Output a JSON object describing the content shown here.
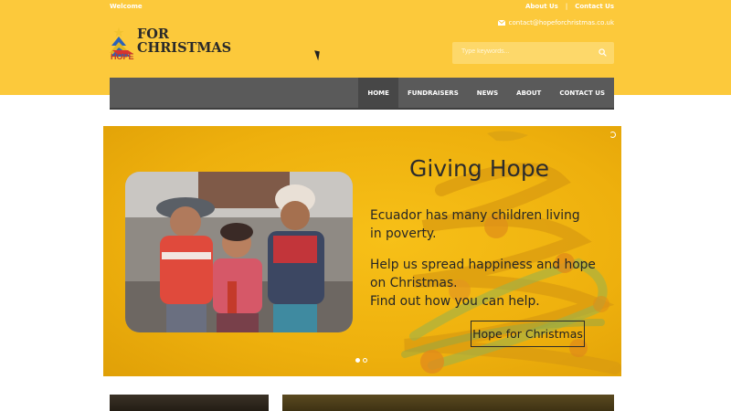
{
  "topbar": {
    "welcome": "Welcome",
    "links": [
      "About Us",
      "Contact Us"
    ],
    "separator": "|",
    "email": "contact@hopeforchristmas.co.uk"
  },
  "logo": {
    "line1": "FOR",
    "line2": "CHRISTMAS",
    "hope": "HOPE"
  },
  "search": {
    "placeholder": "Type keywords..."
  },
  "nav": {
    "items": [
      "HOME",
      "FUNDRAISERS",
      "NEWS",
      "ABOUT",
      "CONTACT US"
    ],
    "active": "HOME"
  },
  "slide": {
    "title": "Giving Hope",
    "line1": "Ecuador has many children living",
    "line2": "in poverty.",
    "line3": "Help us spread happiness and hope",
    "line4": "on Christmas.",
    "line5": "Find out how you can help.",
    "button": "Hope for Christmas",
    "dots": 2,
    "active_dot": 0
  },
  "colors": {
    "header": "#fcc93b",
    "nav": "#5a5a5a",
    "slide": "#f2b80f"
  },
  "icons": [
    "mail-icon",
    "search-icon",
    "logo-tree-icon"
  ]
}
